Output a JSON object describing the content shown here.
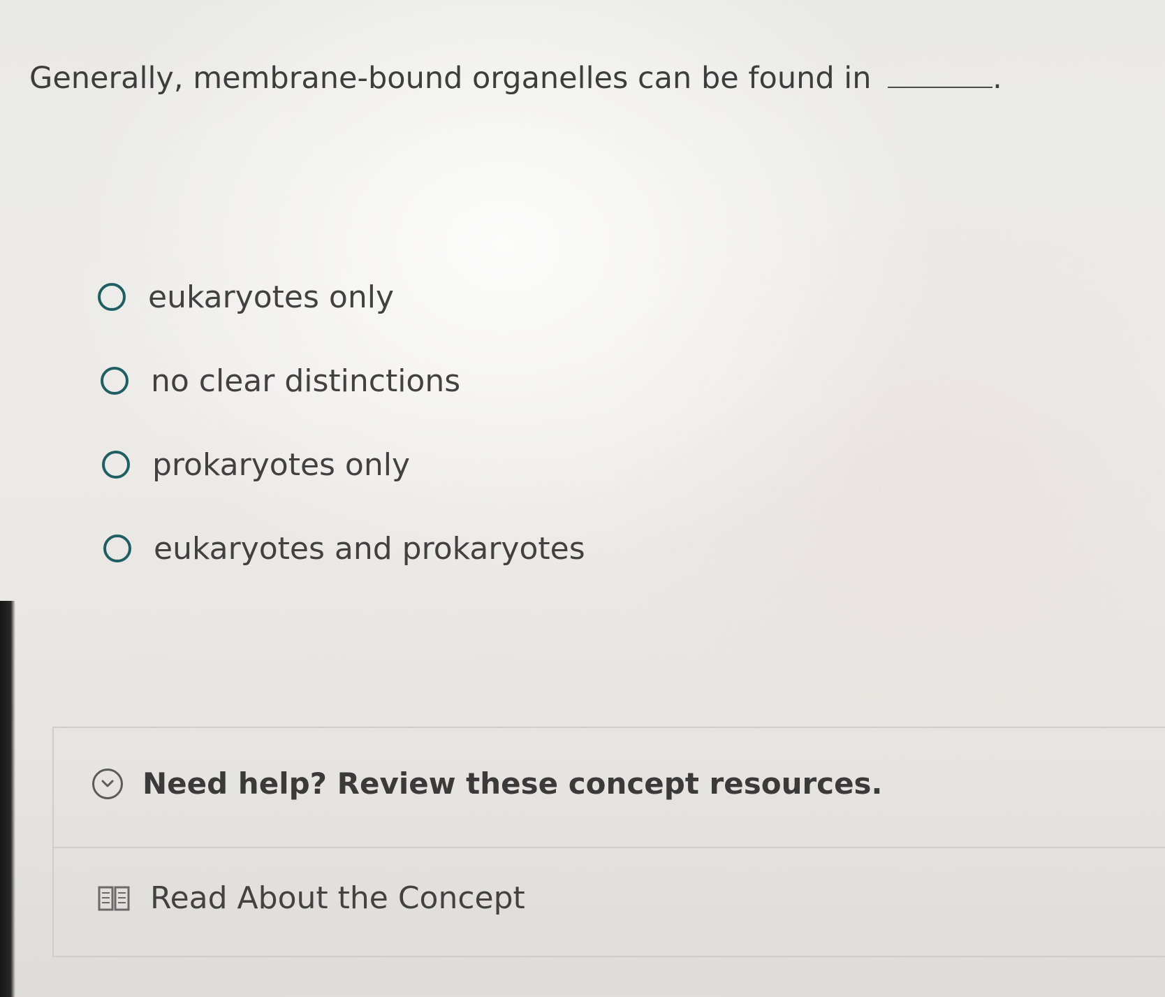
{
  "question": {
    "text": "Generally, membrane-bound organelles can be found in",
    "trailing": "."
  },
  "options": [
    {
      "label": "eukaryotes only"
    },
    {
      "label": "no clear distinctions"
    },
    {
      "label": "prokaryotes only"
    },
    {
      "label": "eukaryotes and prokaryotes"
    }
  ],
  "help": {
    "title": "Need help? Review these concept resources.",
    "resource_label": "Read About the Concept"
  },
  "icons": {
    "toggle": "chevron-down-icon",
    "resource": "book-icon"
  },
  "colors": {
    "radio_border": "#1f5e63",
    "text": "#3f3f3f"
  }
}
